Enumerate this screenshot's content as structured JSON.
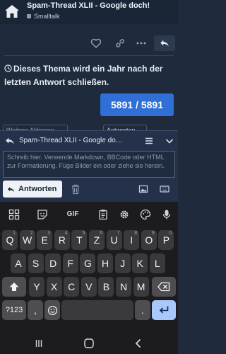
{
  "header": {
    "title": "Spam-Thread XLII - Google doch!",
    "category": "Smalltalk",
    "colors": {
      "bar": "#1a2536",
      "category_swatch": "#8c9aa8"
    }
  },
  "post_actions": [
    "heart-icon",
    "link-icon",
    "ellipsis-icon",
    "reply-icon"
  ],
  "notice": {
    "icon": "clock-icon",
    "text": "Dieses Thema wird ein Jahr nach der letzten Antwort schließen."
  },
  "counter": {
    "text": "5891 / 5891",
    "color": "#2f6fd6"
  },
  "peek": {
    "left_text": "Weitere Aktionen",
    "right_text": "Antworten"
  },
  "composer": {
    "title": "Spam-Thread XLII - Google do…",
    "placeholder": "Schreib hier. Verwende Markdown, BBCode oder HTML zur Formatierung. Füge Bilder ein oder ziehe sie herein.",
    "submit_label": "Antworten",
    "controls": [
      "reply-icon",
      "menu-icon",
      "minimize-icon",
      "chevron-down-icon"
    ],
    "footer_icons": [
      "trash-icon",
      "image-icon",
      "keyboard-icon"
    ]
  },
  "keyboard": {
    "toolbar": [
      "grid-icon",
      "sticker-icon",
      "GIF",
      "clipboard-icon",
      "gear-icon",
      "palette-icon",
      "mic-icon"
    ],
    "row1": [
      {
        "k": "Q",
        "h": "1"
      },
      {
        "k": "W",
        "h": "2"
      },
      {
        "k": "E",
        "h": "3"
      },
      {
        "k": "R",
        "h": "4"
      },
      {
        "k": "T",
        "h": "5"
      },
      {
        "k": "Z",
        "h": "6"
      },
      {
        "k": "U",
        "h": "7"
      },
      {
        "k": "I",
        "h": "8"
      },
      {
        "k": "O",
        "h": "9"
      },
      {
        "k": "P",
        "h": "0"
      }
    ],
    "row2": [
      "A",
      "S",
      "D",
      "F",
      "G",
      "H",
      "J",
      "K",
      "L"
    ],
    "row3": [
      "Y",
      "X",
      "C",
      "V",
      "B",
      "N",
      "M"
    ],
    "symbols_label": "?123",
    "comma": ",",
    "period": ".",
    "accent": "#a8c7fa"
  },
  "navbar": [
    "back-icon",
    "home-icon",
    "recents-icon"
  ]
}
